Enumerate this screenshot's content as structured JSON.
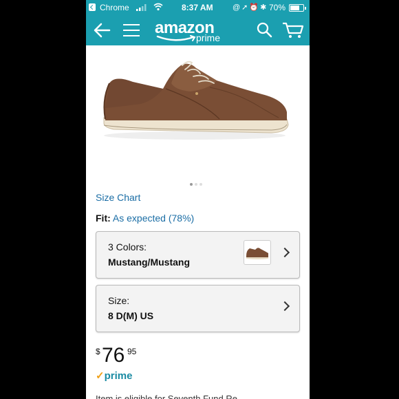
{
  "status_bar": {
    "carrier": "Chrome",
    "time": "8:37 AM",
    "battery_percent": "70%",
    "battery_level": 0.7
  },
  "nav": {
    "logo_word": "amazon",
    "logo_prime": "prime",
    "icons": [
      "back-arrow-icon",
      "menu-icon",
      "search-icon",
      "cart-icon"
    ]
  },
  "product": {
    "image_icon": "shoe-image",
    "gallery_pages": 3,
    "gallery_current": 1
  },
  "size_chart": "Size Chart",
  "fit": {
    "label": "Fit:",
    "value": "As expected (78%)"
  },
  "colors": {
    "label": "3 Colors:",
    "value": "Mustang/Mustang"
  },
  "size": {
    "label": "Size:",
    "value": "8 D(M) US"
  },
  "price": {
    "currency": "$",
    "dollars": "76",
    "cents": "95"
  },
  "prime_badge": "prime",
  "cutoff_text": "Item is eligible for Seventh Fund Re..."
}
